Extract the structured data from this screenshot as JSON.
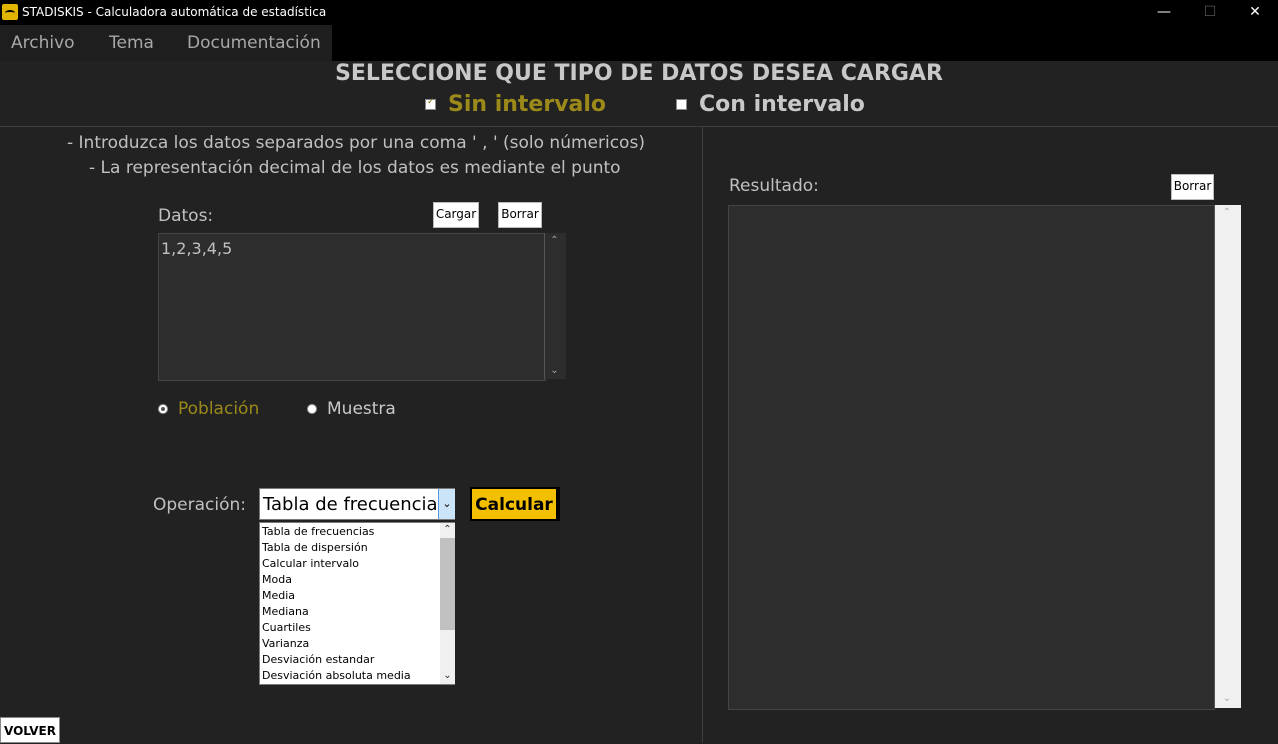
{
  "window": {
    "title": "STADISKIS - Calculadora automática de estadística",
    "minimize": "—",
    "maximize": "☐",
    "close": "✕"
  },
  "menu": [
    "Archivo",
    "Tema",
    "Documentación"
  ],
  "heading": "SELECCIONE QUE TIPO DE DATOS DESEA CARGAR",
  "data_type": {
    "options": [
      {
        "label": "Sin intervalo",
        "checked": true
      },
      {
        "label": "Con intervalo",
        "checked": false
      }
    ]
  },
  "instructions": [
    "- Introduzca los datos separados por una coma ' , ' (solo númericos)",
    "- La representación decimal de los datos es mediante el punto"
  ],
  "datos": {
    "label": "Datos:",
    "load_label": "Cargar",
    "clear_label": "Borrar",
    "value": "1,2,3,4,5"
  },
  "sample_type": {
    "options": [
      {
        "label": "Población",
        "selected": true
      },
      {
        "label": "Muestra",
        "selected": false
      }
    ]
  },
  "operation": {
    "label": "Operación:",
    "selected": "Tabla de frecuencias",
    "calc_label": "Calcular",
    "options": [
      "Tabla de frecuencias",
      "Tabla de dispersión",
      "Calcular intervalo",
      "Moda",
      "Media",
      "Mediana",
      "Cuartiles",
      "Varianza",
      "Desviación estandar",
      "Desviación absoluta media"
    ]
  },
  "result": {
    "label": "Resultado:",
    "clear_label": "Borrar",
    "value": ""
  },
  "back_label": "VOLVER",
  "colors": {
    "accent_selected": "#9b8a1a",
    "accent_button": "#f2c000",
    "background": "#222222"
  }
}
